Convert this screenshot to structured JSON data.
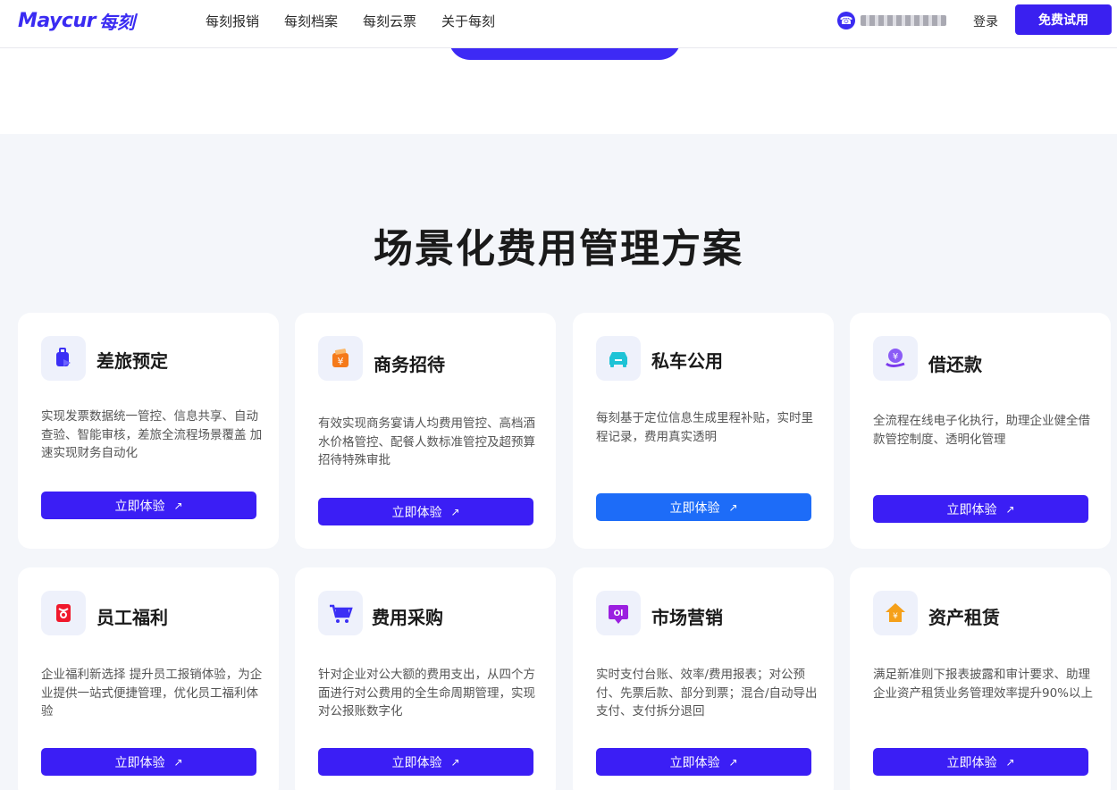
{
  "header": {
    "logo_text": "Maycur",
    "logo_cn": "每刻",
    "nav": [
      "每刻报销",
      "每刻档案",
      "每刻云票",
      "关于每刻"
    ],
    "login": "登录",
    "trial": "免费试用"
  },
  "section": {
    "title": "场景化费用管理方案"
  },
  "cards": [
    {
      "title": "差旅预定",
      "desc": "实现发票数据统一管控、信息共享、自动查验、智能审核，差旅全流程场景覆盖 加速实现财务自动化",
      "button": "立即体验",
      "icon": "travel-booking-icon",
      "color": "#3b2ff5"
    },
    {
      "title": "商务招待",
      "desc": "有效实现商务宴请人均费用管控、高档酒水价格管控、配餐人数标准管控及超预算招待特殊审批",
      "button": "立即体验",
      "icon": "business-hospitality-icon",
      "color": "#f57a1a"
    },
    {
      "title": "私车公用",
      "desc": "每刻基于定位信息生成里程补贴，实时里程记录，费用真实透明",
      "button": "立即体验",
      "icon": "private-car-icon",
      "color": "#1ec3d6"
    },
    {
      "title": "借还款",
      "desc": "全流程在线电子化执行，助理企业健全借款管控制度、透明化管理",
      "button": "立即体验",
      "icon": "loan-repayment-icon",
      "color": "#7c3aed"
    },
    {
      "title": "员工福利",
      "desc": "企业福利新选择 提升员工报销体验，为企业提供一站式便捷管理，优化员工福利体验",
      "button": "立即体验",
      "icon": "employee-benefits-icon",
      "color": "#f0192c"
    },
    {
      "title": "费用采购",
      "desc": "针对企业对公大额的费用支出，从四个方面进行对公费用的全生命周期管理，实现对公报账数字化",
      "button": "立即体验",
      "icon": "shopping-cart-icon",
      "color": "#3b2ff5"
    },
    {
      "title": "市场营销",
      "desc": "实时支付台账、效率/费用报表；对公预付、先票后款、部分到票；混合/自动导出支付、支付拆分退回",
      "button": "立即体验",
      "icon": "marketing-icon",
      "color": "#9b1fe0"
    },
    {
      "title": "资产租赁",
      "desc": "满足新准则下报表披露和审计要求、助理企业资产租赁业务管理效率提升90%以上",
      "button": "立即体验",
      "icon": "asset-leasing-icon",
      "color": "#f5a01a"
    }
  ]
}
